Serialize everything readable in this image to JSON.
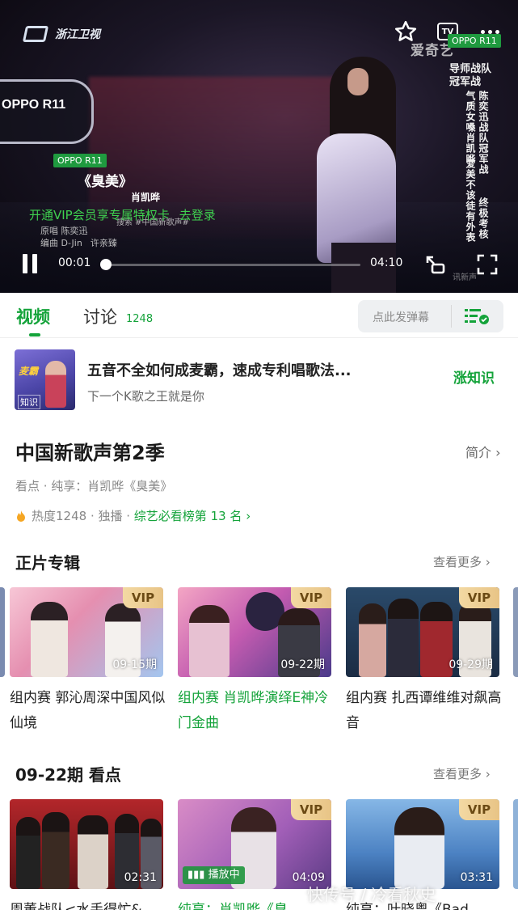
{
  "player": {
    "channel": "浙江卫视",
    "iqiyi": "爱奇艺",
    "tv_label": "TV",
    "sponsor": "OPPO R11",
    "oppo_sign": "OPPO R11",
    "team_line": "导师战队冠军战",
    "vert_col1": "陈奕迅战队冠军战",
    "vert_col2": "终极考核",
    "vert_col3": "爱美不该徒有外表",
    "vert_col4": "气质女嗓肖凯晔",
    "song_title": "《臭美》",
    "singer": "肖凯晔",
    "vip_banner": "开通VIP会员享专属特权卡",
    "login_link": "去登录",
    "credit_1": "原唱 陈奕迅",
    "credit_2": "编曲 D-Jin",
    "credit_3": "许亲臻",
    "hashtag": "搜索 #中国新歌声#",
    "time_current": "00:01",
    "time_total": "04:10",
    "progress": 0.004,
    "small_wm": "讯新声"
  },
  "tabs": {
    "video": "视频",
    "discuss": "讨论",
    "discuss_count": "1248",
    "danmaku_placeholder": "点此发弹幕"
  },
  "promo": {
    "thumb_tag": "麦霸",
    "thumb_badge": "知识",
    "title": "五音不全如何成麦霸，速成专利唱歌法...",
    "subtitle": "下一个K歌之王就是你",
    "action": "涨知识"
  },
  "show": {
    "title": "中国新歌声第2季",
    "intro": "简介 ›",
    "desc": "看点 · 纯享：肖凯晔《臭美》",
    "heat": "热度1248",
    "exclusive": " · 独播 · ",
    "rank": "综艺必看榜第 13 名 ›"
  },
  "album": {
    "title": "正片专辑",
    "more": "查看更多 ›",
    "cards": [
      {
        "vip": "VIP",
        "duration": "09-15期",
        "title": "组内赛 郭沁周深中国风似仙境"
      },
      {
        "vip": "VIP",
        "duration": "09-22期",
        "title": "组内赛 肖凯晔演绎E神冷门金曲"
      },
      {
        "vip": "VIP",
        "duration": "09-29期",
        "title": "组内赛 扎西谭维维对飙高音"
      }
    ]
  },
  "highlights": {
    "title": "09-22期 看点",
    "more": "查看更多 ›",
    "cards": [
      {
        "vip": "",
        "duration": "02:31",
        "title": "周董战队<水手得忙&"
      },
      {
        "vip": "VIP",
        "duration": "04:09",
        "playing": "播放中",
        "title": "纯享：肖凯晔《臭"
      },
      {
        "vip": "VIP",
        "duration": "03:31",
        "title": "纯享：叶晓粤《Bad"
      }
    ]
  },
  "watermark": "快传号 / 冷看秋史",
  "colors": {
    "accent": "#14a33a",
    "vip_gold": "#e8c486"
  }
}
